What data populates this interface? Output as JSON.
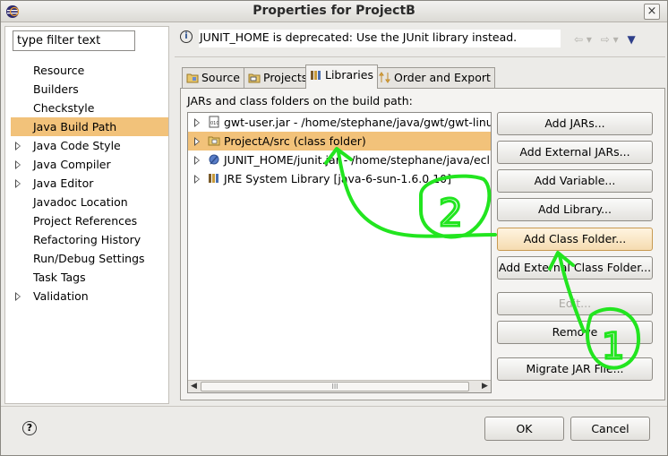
{
  "window": {
    "title": "Properties for ProjectB",
    "close_label": "×"
  },
  "filter": {
    "value": "type filter text"
  },
  "sidebar": {
    "items": [
      {
        "label": "Resource",
        "expandable": false
      },
      {
        "label": "Builders",
        "expandable": false
      },
      {
        "label": "Checkstyle",
        "expandable": false
      },
      {
        "label": "Java Build Path",
        "expandable": false,
        "selected": true
      },
      {
        "label": "Java Code Style",
        "expandable": true
      },
      {
        "label": "Java Compiler",
        "expandable": true
      },
      {
        "label": "Java Editor",
        "expandable": true
      },
      {
        "label": "Javadoc Location",
        "expandable": false
      },
      {
        "label": "Project References",
        "expandable": false
      },
      {
        "label": "Refactoring History",
        "expandable": false
      },
      {
        "label": "Run/Debug Settings",
        "expandable": false
      },
      {
        "label": "Task Tags",
        "expandable": false
      },
      {
        "label": "Validation",
        "expandable": true
      }
    ]
  },
  "message": {
    "text": "JUNIT_HOME is deprecated: Use the JUnit library instead."
  },
  "tabs": [
    {
      "label": "Source"
    },
    {
      "label": "Projects"
    },
    {
      "label": "Libraries",
      "active": true
    },
    {
      "label": "Order and Export"
    }
  ],
  "panel": {
    "label": "JARs and class folders on the build path:",
    "entries": [
      {
        "label": "gwt-user.jar - /home/stephane/java/gwt/gwt-linux-",
        "icon": "jar-icon"
      },
      {
        "label": "ProjectA/src (class folder)",
        "icon": "class-folder-icon",
        "selected": true
      },
      {
        "label": "JUNIT_HOME/junit.jar - /home/stephane/java/eclips",
        "icon": "variable-icon"
      },
      {
        "label": "JRE System Library [java-6-sun-1.6.0.10]",
        "icon": "library-icon"
      }
    ]
  },
  "buttons": {
    "add_jars": "Add JARs...",
    "add_external_jars": "Add External JARs...",
    "add_variable": "Add Variable...",
    "add_library": "Add Library...",
    "add_class_folder": "Add Class Folder...",
    "add_external_class_folder": "Add External Class Folder...",
    "edit": "Edit...",
    "remove": "Remove",
    "migrate_jar": "Migrate JAR File..."
  },
  "annotations": {
    "step_1": "1",
    "step_2": "2",
    "color": "#22e51f"
  },
  "footer": {
    "ok": "OK",
    "cancel": "Cancel",
    "help": "?"
  }
}
